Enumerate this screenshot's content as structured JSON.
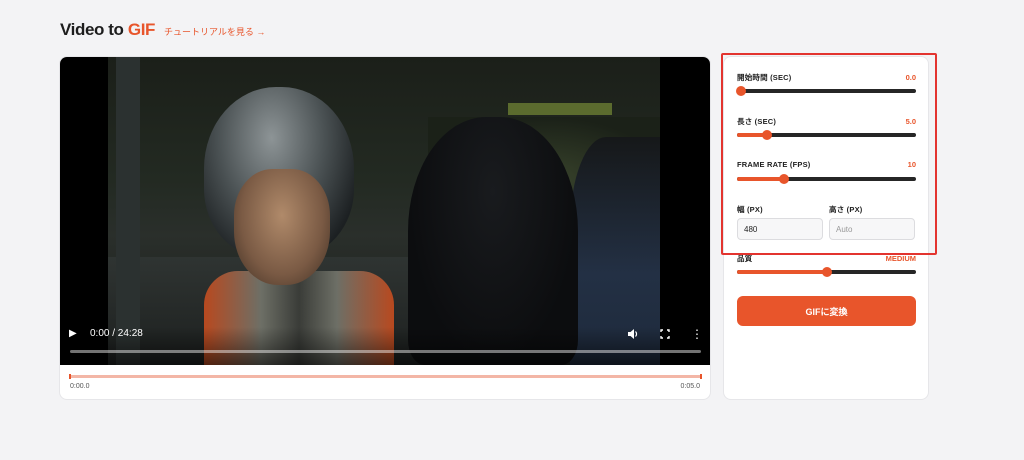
{
  "header": {
    "title_prefix": "Video to ",
    "title_accent": "GIF",
    "tutorial_link": "チュートリアルを見る →"
  },
  "video": {
    "time_display": "0:00 / 24:28",
    "progress": 0,
    "icons": [
      "play-icon",
      "volume-icon",
      "fullscreen-icon",
      "more-vert-icon"
    ]
  },
  "trim": {
    "start_label": "0:00.0",
    "end_label": "0:05.0",
    "start_fraction": 0.0,
    "end_fraction": 1.0
  },
  "settings": {
    "start_time": {
      "label": "開始時間 (SEC)",
      "value": "0.0",
      "fraction": 0.02
    },
    "duration": {
      "label": "長さ (SEC)",
      "value": "5.0",
      "fraction": 0.17
    },
    "frame_rate": {
      "label": "FRAME RATE (FPS)",
      "value": "10",
      "fraction": 0.26
    },
    "width": {
      "label": "幅 (PX)",
      "value": "480"
    },
    "height": {
      "label": "高さ (PX)",
      "placeholder": "Auto"
    },
    "quality": {
      "label": "品質",
      "value": "MEDIUM",
      "fraction": 0.5
    },
    "convert_label": "GIFに変換"
  },
  "colors": {
    "accent": "#e8552b",
    "highlight": "#e3342f",
    "track": "#262626"
  }
}
